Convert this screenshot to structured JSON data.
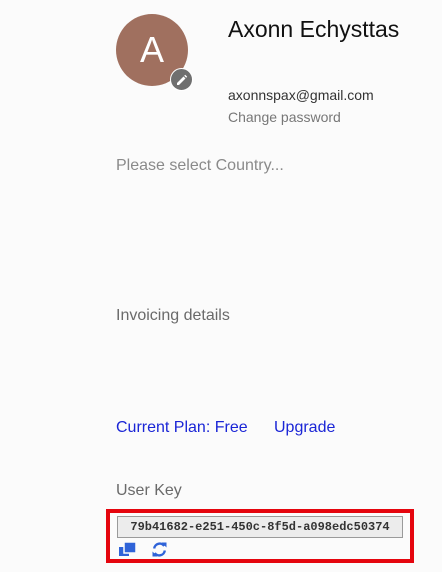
{
  "profile": {
    "avatar_initial": "A",
    "avatar_color": "#a0705f",
    "name": "Axonn Echysttas",
    "email": "axonnspax@gmail.com",
    "change_password_label": "Change password",
    "edit_icon": "pencil-icon"
  },
  "country": {
    "placeholder": "Please select Country..."
  },
  "invoicing": {
    "label": "Invoicing details"
  },
  "plan": {
    "current_plan_label": "Current Plan: Free",
    "upgrade_label": "Upgrade",
    "link_color": "#1a25d6"
  },
  "user_key": {
    "label": "User Key",
    "value": "79b41682-e251-450c-8f5d-a098edc50374",
    "copy_icon": "copy-icon",
    "refresh_icon": "refresh-icon",
    "highlight_color": "#e5050e"
  }
}
